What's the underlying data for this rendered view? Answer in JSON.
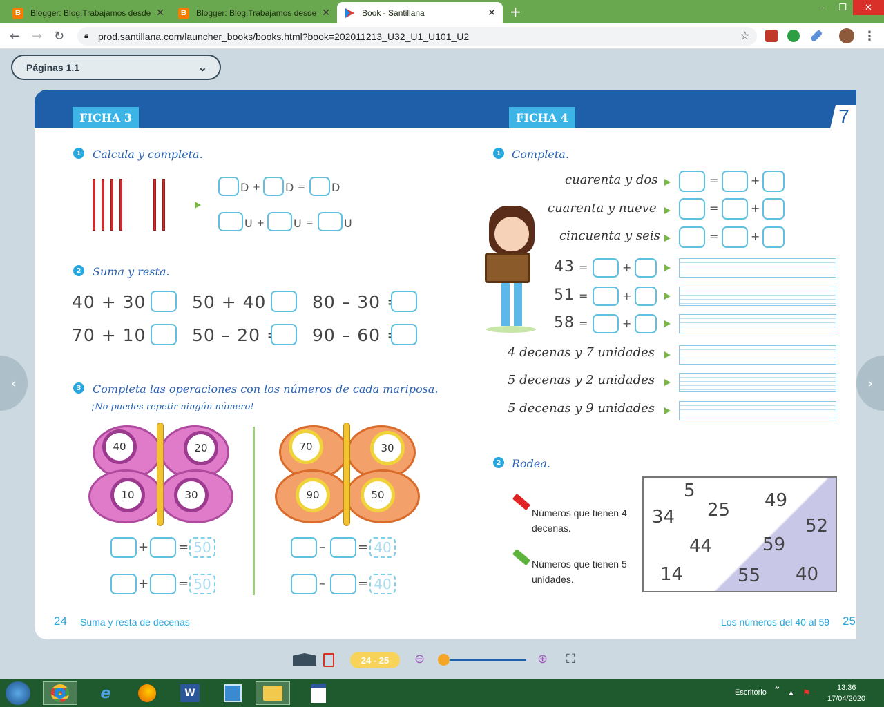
{
  "browser": {
    "tabs": [
      {
        "title": "Blogger: Blog.Trabajamos desde",
        "favicon": "B"
      },
      {
        "title": "Blogger: Blog.Trabajamos desde",
        "favicon": "B"
      },
      {
        "title": "Book - Santillana",
        "favicon": "play"
      }
    ],
    "new_tab": "+",
    "url": "prod.santillana.com/launcher_books/books.html?book=202011213_U32_U1_U101_U2",
    "win": {
      "min": "–",
      "max": "❐",
      "close": "✕"
    }
  },
  "viewer": {
    "page_select": "Páginas 1.1",
    "page_range": "24 - 25",
    "zoom_level": 0.02
  },
  "left": {
    "ficha": "FICHA 3",
    "q1": {
      "n": "1",
      "text": "Calcula y completa.",
      "row1": [
        "D",
        "+",
        "D",
        "=",
        "D"
      ],
      "row2": [
        "U",
        "+",
        "U",
        "=",
        "U"
      ]
    },
    "q2": {
      "n": "2",
      "text": "Suma y resta.",
      "ops": [
        "40 + 30 =",
        "50 + 40 =",
        "80 – 30 =",
        "70 + 10 =",
        "50 – 20 =",
        "90 – 60 ="
      ]
    },
    "q3": {
      "n": "3",
      "text": "Completa las operaciones con los números de cada mariposa.",
      "sub": "¡No puedes repetir ningún número!",
      "b1": [
        "40",
        "20",
        "10",
        "30"
      ],
      "b2": [
        "70",
        "30",
        "90",
        "50"
      ],
      "sum_hint": "50",
      "diff_hint": "40",
      "plus": "+",
      "minus": "–",
      "eq": "="
    },
    "page_number": "24",
    "footer": "Suma y resta de decenas"
  },
  "right": {
    "ficha": "FICHA 4",
    "page_badge": "7",
    "q1": {
      "n": "1",
      "text": "Completa.",
      "words": [
        "cuarenta y dos",
        "cuarenta y nueve",
        "cincuenta y seis"
      ],
      "nums": [
        "43",
        "51",
        "58"
      ],
      "desc": [
        "4 decenas y 7 unidades",
        "5 decenas y 2 unidades",
        "5 decenas y 9 unidades"
      ],
      "eq": "=",
      "plus": "+"
    },
    "q2": {
      "n": "2",
      "text": "Rodea.",
      "red": "Números que tienen 4 decenas.",
      "green": "Números que tienen 5 unidades.",
      "board": [
        "5",
        "25",
        "49",
        "34",
        "52",
        "44",
        "59",
        "14",
        "55",
        "40"
      ]
    },
    "page_number": "25",
    "footer": "Los números del 40 al 59"
  },
  "taskbar": {
    "desktop": "Escritorio",
    "time": "13:36",
    "date": "17/04/2020"
  }
}
